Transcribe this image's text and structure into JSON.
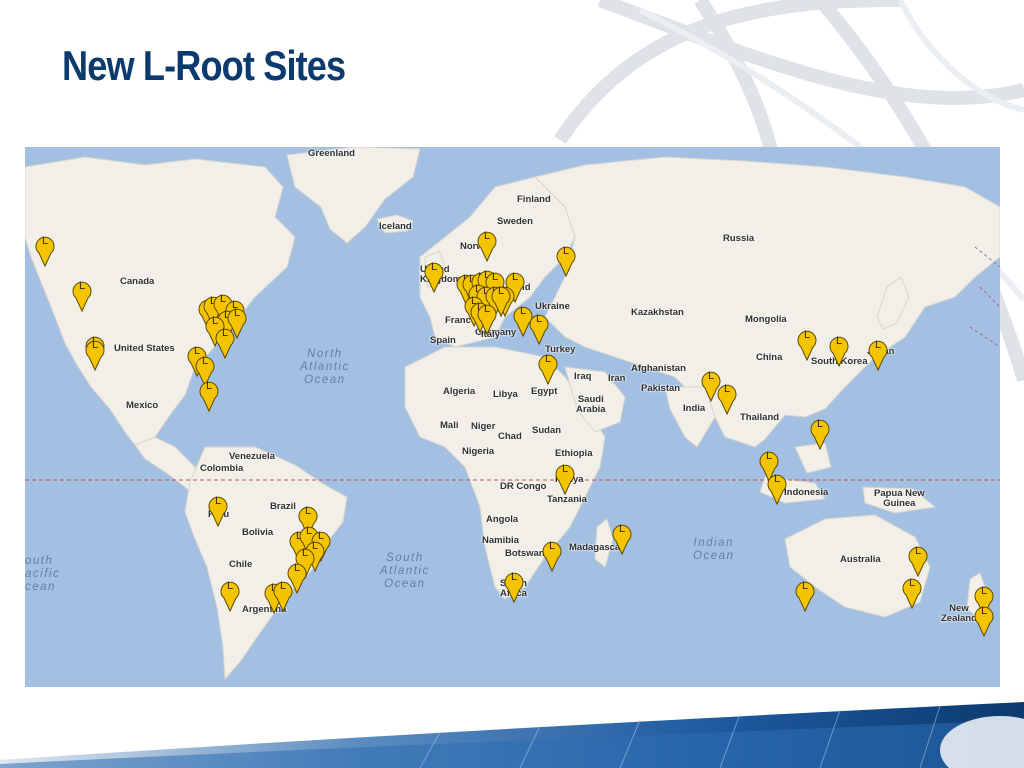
{
  "slide": {
    "title": "New L-Root Sites"
  },
  "map": {
    "marker_letter": "L",
    "marker_color": "#f5c400",
    "water_color": "#a3c0e3",
    "land_color": "#f1efe8",
    "equator_color": "#c0504d",
    "country_labels": {
      "greenland": "Greenland",
      "iceland": "Iceland",
      "finland": "Finland",
      "sweden": "Sweden",
      "norway": "Norway",
      "united_kingdom": "United\nKingdom",
      "ireland": "land",
      "russia": "Russia",
      "canada": "Canada",
      "kazakhstan": "Kazakhstan",
      "ukraine": "Ukraine",
      "germany": "Germany",
      "france": "France",
      "italy": "Italy",
      "spain": "Spain",
      "turkey": "Turkey",
      "mongolia": "Mongolia",
      "china": "China",
      "south_korea": "South Korea",
      "japan": "Japan",
      "united_states": "United States",
      "iraq": "Iraq",
      "iran": "Iran",
      "afghanistan": "Afghanistan",
      "pakistan": "Pakistan",
      "algeria": "Algeria",
      "libya": "Libya",
      "egypt": "Egypt",
      "saudi_arabia": "Saudi\nArabia",
      "india": "India",
      "mexico": "Mexico",
      "thailand": "Thailand",
      "mali": "Mali",
      "niger": "Niger",
      "chad": "Chad",
      "sudan": "Sudan",
      "venezuela": "Venezuela",
      "nigeria": "Nigeria",
      "ethiopia": "Ethiopia",
      "colombia": "Colombia",
      "kenya": "Kenya",
      "dr_congo": "DR Congo",
      "indonesia": "Indonesia",
      "papua_new_guinea": "Papua New\nGuinea",
      "tanzania": "Tanzania",
      "peru": "Peru",
      "brazil": "Brazil",
      "bolivia": "Bolivia",
      "angola": "Angola",
      "namibia": "Namibia",
      "madagascar": "Madagascar",
      "botswana": "Botswana",
      "australia": "Australia",
      "chile": "Chile",
      "south_africa": "South\nAfrica",
      "argentina": "Argentina",
      "new_zealand": "New\nZealand"
    },
    "ocean_labels": {
      "north_atlantic": "North\nAtlantic\nOcean",
      "south_atlantic": "South\nAtlantic\nOcean",
      "indian": "Indian\nOcean",
      "south_pacific": "outh\nacific\ncean"
    },
    "marker_count": 62
  }
}
